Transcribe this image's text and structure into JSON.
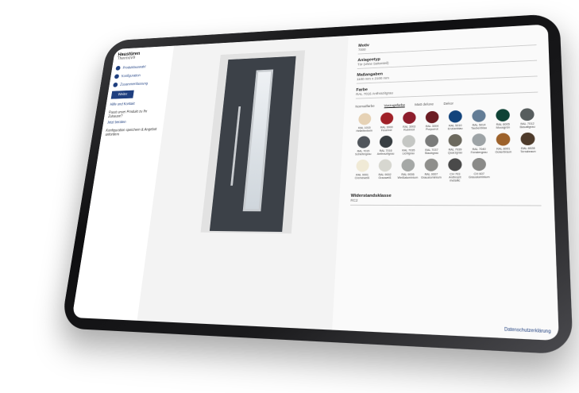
{
  "sidebar": {
    "title": "Haustüren",
    "subtitle": "ThermoV9",
    "steps": [
      "Produktauswahl",
      "Konfiguration",
      "Zusammenfassung"
    ],
    "button": "Weiter",
    "link": "Hilfe und Kontakt",
    "info_title": "Passt unser Produkt zu Ihr Zuhause?",
    "info_link": "Jetzt beraten",
    "info_text": "Konfiguration speichern & Angebot anfordern"
  },
  "config": {
    "fields": [
      {
        "label": "Motiv",
        "value": "7000"
      },
      {
        "label": "Anlageetyp",
        "value": "Tür (ohne Seitenteil)"
      },
      {
        "label": "Maßangaben",
        "value": "1100 mm x 2100 mm"
      },
      {
        "label": "Farbe",
        "value": "RAL 7016 Anthrazitgrau"
      }
    ],
    "tabs": [
      "Normalfarbe",
      "Vorzugsfarbe",
      "Matt deluxe",
      "Dekor"
    ],
    "colors": [
      {
        "name": "RAL 1015 Hellelfenbein",
        "hex": "#e6d2b5"
      },
      {
        "name": "RAL 3000 Feuerrot",
        "hex": "#a02128"
      },
      {
        "name": "RAL 3003 Rubinrot",
        "hex": "#8d1d2c"
      },
      {
        "name": "RAL 3004 Purpurrot",
        "hex": "#6b1c23"
      },
      {
        "name": "RAL 5010 Enzianblau",
        "hex": "#13447c"
      },
      {
        "name": "RAL 5014 Taubenblau",
        "hex": "#637d96"
      },
      {
        "name": "RAL 6005 Moosgrün",
        "hex": "#0f4336"
      },
      {
        "name": "RAL 7012 Basaltgrau",
        "hex": "#575d5e"
      },
      {
        "name": "RAL 7015 Schiefergrau",
        "hex": "#51565c"
      },
      {
        "name": "RAL 7016 Anthrazitgrau",
        "hex": "#383e42"
      },
      {
        "name": "RAL 7035 Lichtgrau",
        "hex": "#c5c7c4"
      },
      {
        "name": "RAL 7037 Staubgrau",
        "hex": "#7a7b7a"
      },
      {
        "name": "RAL 7039 Quarzgrau",
        "hex": "#6c695e"
      },
      {
        "name": "RAL 7040 Fenstergrau",
        "hex": "#9da3a6"
      },
      {
        "name": "RAL 8001 Ockerbraun",
        "hex": "#9d622b"
      },
      {
        "name": "RAL 8028 Terrabraun",
        "hex": "#4e3b2b"
      },
      {
        "name": "RAL 9001 Cremeweiß",
        "hex": "#f0ead6"
      },
      {
        "name": "RAL 9002 Grauweiß",
        "hex": "#d7d7d0"
      },
      {
        "name": "RAL 9006 Weißaluminium",
        "hex": "#a5a8a6"
      },
      {
        "name": "RAL 9007 Graualuminium",
        "hex": "#8f8f8c"
      },
      {
        "name": "CH 703 Anthrazit metallic",
        "hex": "#4a4a4a"
      },
      {
        "name": "CH 607 Graualuminium",
        "hex": "#8a8a88"
      }
    ],
    "resistance_label": "Widerstandsklasse",
    "resistance_value": "RC2",
    "footer": "Datenschutzerklärung"
  }
}
